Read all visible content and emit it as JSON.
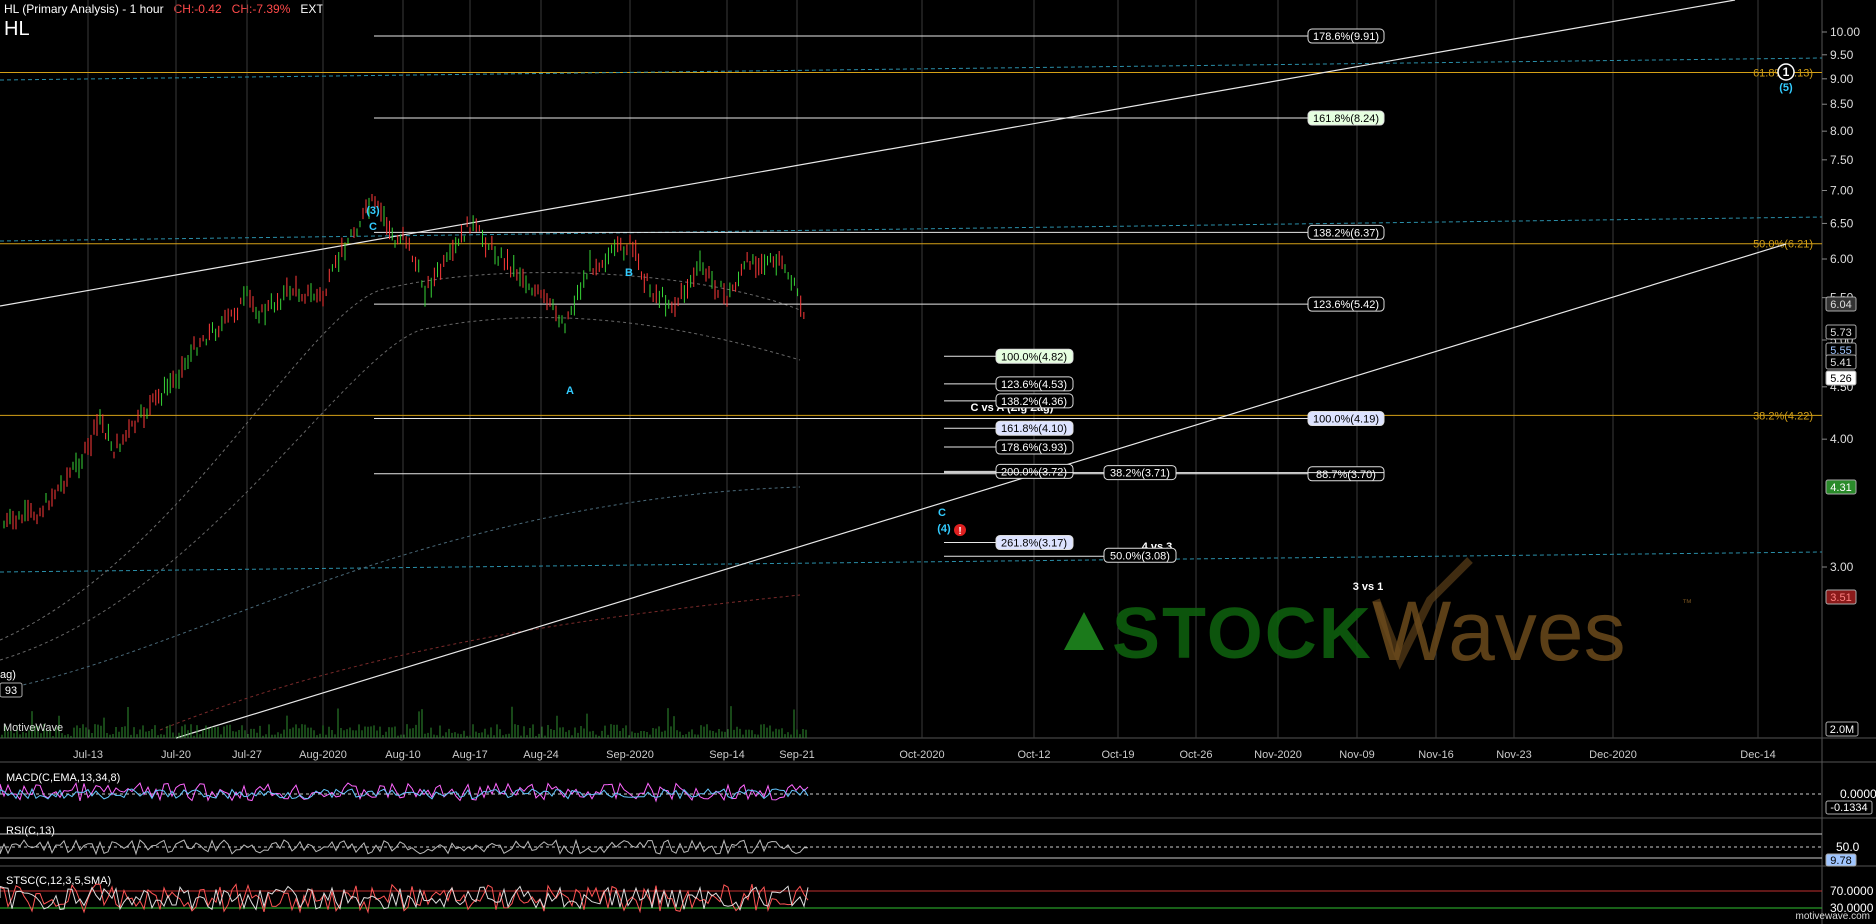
{
  "header": {
    "title": "HL (Primary Analysis) - 1 hour",
    "ch_abs": "CH:-0.42",
    "ch_pct": "CH:-7.39%",
    "ext": "EXT",
    "symbol": "HL"
  },
  "credit": "MotiveWave",
  "credit_url": "motivewave.com",
  "chart_data": {
    "type": "line",
    "title": "HL (Primary Analysis) - 1 hour",
    "y_scale": "log",
    "ylim": [
      2.5,
      10.6
    ],
    "y_ticks": [
      "10.00",
      "9.50",
      "9.00",
      "8.50",
      "8.00",
      "7.50",
      "7.00",
      "6.50",
      "6.00",
      "5.50",
      "5.00",
      "4.50",
      "4.00",
      "3.00"
    ],
    "x_ticks": [
      "Jul-13",
      "Jul-20",
      "Jul-27",
      "Aug-2020",
      "Aug-10",
      "Aug-17",
      "Aug-24",
      "Sep-2020",
      "Sep-14",
      "Sep-21",
      "Oct-2020",
      "Oct-12",
      "Oct-19",
      "Oct-26",
      "Nov-2020",
      "Nov-09",
      "Nov-16",
      "Nov-23",
      "Dec-2020",
      "Dec-14"
    ],
    "price_path": [
      {
        "x": "Jul-08",
        "y": 3.3
      },
      {
        "x": "Jul-10",
        "y": 3.4
      },
      {
        "x": "Jul-13",
        "y": 3.9
      },
      {
        "x": "Jul-14",
        "y": 4.2
      },
      {
        "x": "Jul-15",
        "y": 3.9
      },
      {
        "x": "Jul-17",
        "y": 4.3
      },
      {
        "x": "Jul-20",
        "y": 4.6
      },
      {
        "x": "Jul-22",
        "y": 5.0
      },
      {
        "x": "Jul-24",
        "y": 5.2
      },
      {
        "x": "Jul-27",
        "y": 5.5
      },
      {
        "x": "Jul-28",
        "y": 5.3
      },
      {
        "x": "Jul-30",
        "y": 5.6
      },
      {
        "x": "Aug-2020",
        "y": 5.5
      },
      {
        "x": "Aug-03",
        "y": 6.2
      },
      {
        "x": "Aug-05",
        "y": 6.8
      },
      {
        "x": "Aug-06",
        "y": 6.6
      },
      {
        "x": "Aug-07",
        "y": 6.2
      },
      {
        "x": "Aug-10",
        "y": 6.4
      },
      {
        "x": "Aug-12",
        "y": 5.6
      },
      {
        "x": "Aug-14",
        "y": 6.0
      },
      {
        "x": "Aug-17",
        "y": 6.5
      },
      {
        "x": "Aug-19",
        "y": 6.1
      },
      {
        "x": "Aug-21",
        "y": 5.8
      },
      {
        "x": "Aug-24",
        "y": 5.5
      },
      {
        "x": "Aug-25",
        "y": 5.2
      },
      {
        "x": "Aug-27",
        "y": 5.9
      },
      {
        "x": "Sep-2020",
        "y": 6.2
      },
      {
        "x": "Sep-03",
        "y": 5.6
      },
      {
        "x": "Sep-08",
        "y": 5.4
      },
      {
        "x": "Sep-10",
        "y": 5.9
      },
      {
        "x": "Sep-14",
        "y": 5.5
      },
      {
        "x": "Sep-16",
        "y": 6.0
      },
      {
        "x": "Sep-18",
        "y": 5.9
      },
      {
        "x": "Sep-21",
        "y": 5.26
      }
    ],
    "price_labels": [
      {
        "text": "6.04",
        "color": "#cfcfcf"
      },
      {
        "text": "5.73",
        "color": "#cfcfcf"
      },
      {
        "text": "5.55",
        "color": "#9fc5ff"
      },
      {
        "text": "5.41",
        "color": "#cfcfcf"
      },
      {
        "text": "5.26",
        "color": "#ffffff"
      },
      {
        "text": "4.31",
        "color": "#39b339"
      },
      {
        "text": "3.51",
        "color": "#e03030"
      },
      {
        "text": "2.0M",
        "color": "#ffffff"
      },
      {
        "text": "93",
        "color": "#ffffff"
      }
    ],
    "fib_levels": [
      {
        "label": "178.6%(9.91)",
        "value": 9.91,
        "bg": "#000000",
        "fg": "#ffffff"
      },
      {
        "label": "161.8%(8.24)",
        "value": 8.24,
        "bg": "#e6ffe0",
        "fg": "#000000"
      },
      {
        "label": "138.2%(6.37)",
        "value": 6.37,
        "bg": "#000000",
        "fg": "#ffffff"
      },
      {
        "label": "123.6%(5.42)",
        "value": 5.42,
        "bg": "#000000",
        "fg": "#ffffff"
      },
      {
        "label": "100.0%(4.19)",
        "value": 4.19,
        "bg": "#dde3ff",
        "fg": "#000000"
      },
      {
        "label": "88.7%(3.70)",
        "value": 3.7,
        "bg": "#000000",
        "fg": "#ffffff"
      }
    ],
    "zigzag_title": "C vs A (Zig Zag)",
    "zigzag_levels": [
      {
        "label": "100.0%(4.82)",
        "value": 4.82,
        "bg": "#e6ffe0",
        "fg": "#000000"
      },
      {
        "label": "123.6%(4.53)",
        "value": 4.53,
        "bg": "#000000",
        "fg": "#ffffff"
      },
      {
        "label": "138.2%(4.36)",
        "value": 4.36,
        "bg": "#000000",
        "fg": "#ffffff"
      },
      {
        "label": "161.8%(4.10)",
        "value": 4.1,
        "bg": "#dde3ff",
        "fg": "#000000"
      },
      {
        "label": "178.6%(3.93)",
        "value": 3.93,
        "bg": "#000000",
        "fg": "#ffffff"
      },
      {
        "label": "200.0%(3.72)",
        "value": 3.72,
        "bg": "#000000",
        "fg": "#ffffff"
      },
      {
        "label": "261.8%(3.17)",
        "value": 3.17,
        "bg": "#dde3ff",
        "fg": "#000000"
      }
    ],
    "wave4_title": "4 vs 3",
    "wave4_levels": [
      {
        "label": "38.2%(3.71)",
        "value": 3.71
      },
      {
        "label": "50.0%(3.08)",
        "value": 3.08
      }
    ],
    "wave3_title": "3 vs 1",
    "gold_levels": [
      {
        "label": "61.8%(9.13)",
        "value": 9.13
      },
      {
        "label": "50.0%(6.21)",
        "value": 6.21
      },
      {
        "label": "38.2%(4.22)",
        "value": 4.22
      }
    ],
    "wave_labels": [
      {
        "text": "(3)",
        "color": "#33ccff"
      },
      {
        "text": "C",
        "color": "#33ccff"
      },
      {
        "text": "B",
        "color": "#33ccff"
      },
      {
        "text": "A",
        "color": "#33ccff"
      },
      {
        "text": "C",
        "color": "#33ccff"
      },
      {
        "text": "(4)",
        "color": "#33ccff"
      },
      {
        "text": "1",
        "color": "#ffffff"
      },
      {
        "text": "(5)",
        "color": "#33ccff"
      }
    ],
    "left_label": "ag)",
    "indicators": [
      {
        "name": "MACD(C,EMA,13,34,8)",
        "values": [
          "0.0000",
          "-0.1334"
        ]
      },
      {
        "name": "RSI(C,13)",
        "values": [
          "50.0",
          "9.78"
        ]
      },
      {
        "name": "STSC(C,12,3,5,SMA)",
        "values": [
          "70.0000",
          "30.0000"
        ]
      }
    ]
  },
  "watermark": {
    "brand1": "STOCK",
    "brand2": "Waves",
    "tm": "™"
  },
  "colors": {
    "gold": "#d4a017",
    "cyan": "#33ccff",
    "grid": "#3a3a3a",
    "white_line": "#e8e8e8"
  }
}
